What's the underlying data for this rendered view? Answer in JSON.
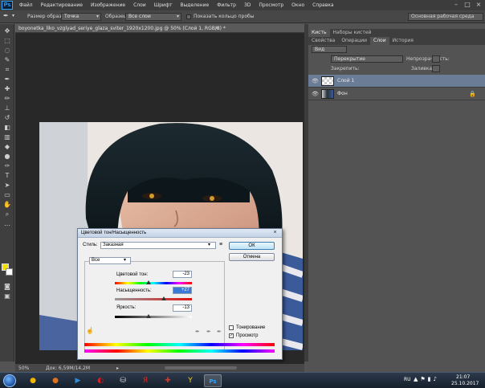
{
  "app": {
    "logo": "Ps",
    "menus": [
      "Файл",
      "Редактирование",
      "Изображение",
      "Слои",
      "Шрифт",
      "Выделение",
      "Фильтр",
      "3D",
      "Просмотр",
      "Окно",
      "Справка"
    ]
  },
  "options_bar": {
    "sample_size_label": "Размер образца:",
    "sample_size_value": "Точка",
    "sample_label": "Образец:",
    "sample_value": "Все слои",
    "show_ring_label": "Показать кольцо пробы",
    "workspace_value": "Основная рабочая среда"
  },
  "document": {
    "tab_title": "boyonetka_liko_vzglyad_seriye_glaza_sviter_1920x1200.jpg @ 50% (Слой 1, RGB/8) *",
    "close_symbol": "×"
  },
  "status_bar": {
    "zoom": "50%",
    "doc_size": "Док: 6,59M/14,2M",
    "arrow": "▸"
  },
  "panels": {
    "top_tabs": [
      "Кисть",
      "Наборы кистей"
    ],
    "layer_tabs": [
      "Свойства",
      "Операции",
      "Слои",
      "История"
    ],
    "active_layer_tab": "Слои",
    "filter_kind": "Вид",
    "blend_mode": "Перекрытие",
    "opacity_label": "Непрозрачность:",
    "lock_label": "Закрепить:",
    "fill_label": "Заливка:",
    "layers": [
      {
        "name": "Слой 1",
        "visible": true,
        "locked": false
      },
      {
        "name": "Фон",
        "visible": true,
        "locked": true
      }
    ]
  },
  "dialog": {
    "title": "Цветовой тон/Насыщенность",
    "close_symbol": "×",
    "preset_label": "Стиль:",
    "preset_value": "Заказная",
    "ok_label": "ОК",
    "cancel_label": "Отмена",
    "channel_value": "Все",
    "hue_label": "Цветовой тон:",
    "hue_value": "-23",
    "hue_range": [
      -180,
      180
    ],
    "saturation_label": "Насыщенность:",
    "saturation_value": "+27",
    "saturation_range": [
      -100,
      100
    ],
    "lightness_label": "Яркость:",
    "lightness_value": "-13",
    "lightness_range": [
      -100,
      100
    ],
    "colorize_label": "Тонирование",
    "colorize_checked": false,
    "preview_label": "Просмотр",
    "preview_checked": true
  },
  "taskbar": {
    "apps": [
      {
        "name": "chrome",
        "glyph": "●",
        "color": "#f3b400"
      },
      {
        "name": "firefox",
        "glyph": "●",
        "color": "#e2711d"
      },
      {
        "name": "media-player",
        "glyph": "▶",
        "color": "#2f8cd8"
      },
      {
        "name": "opera",
        "glyph": "◐",
        "color": "#d61f26"
      },
      {
        "name": "yandex-disk",
        "glyph": "⛁",
        "color": "#d8d8d8"
      },
      {
        "name": "yandex-browser",
        "glyph": "Я",
        "color": "#e52620"
      },
      {
        "name": "app-7",
        "glyph": "✚",
        "color": "#c93b2c"
      },
      {
        "name": "yandex",
        "glyph": "Y",
        "color": "#f6cf2a"
      },
      {
        "name": "photoshop",
        "glyph": "Ps",
        "color": "#31a8ff"
      }
    ],
    "lang": "RU",
    "time": "21:07",
    "date": "25.10.2017"
  }
}
